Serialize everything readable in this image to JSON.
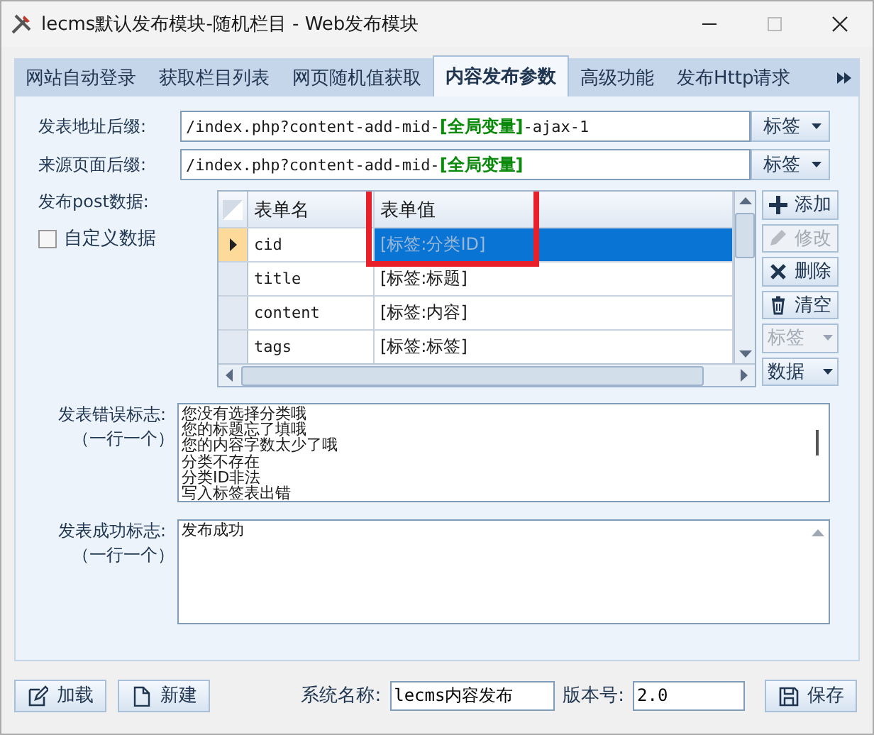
{
  "window": {
    "title": "lecms默认发布模块-随机栏目 - Web发布模块"
  },
  "tabs": [
    {
      "label": "网站自动登录",
      "selected": false
    },
    {
      "label": "获取栏目列表",
      "selected": false
    },
    {
      "label": "网页随机值获取",
      "selected": false
    },
    {
      "label": "内容发布参数",
      "selected": true
    },
    {
      "label": "高级功能",
      "selected": false
    },
    {
      "label": "发布Http请求",
      "selected": false
    }
  ],
  "fields": [
    {
      "label": "发表地址后缀:",
      "value": "/index.php?content-add-mid-**[全局变量]**-ajax-1",
      "button": "标签"
    },
    {
      "label": "来源页面后缀:",
      "value": "/index.php?content-add-mid-**[全局变量]**",
      "button": "标签"
    }
  ],
  "post_data": {
    "label": "发布post数据:",
    "custom": {
      "label": "自定义数据",
      "checked": false
    },
    "table": {
      "columns": [
        {
          "label": "表单名",
          "highlighted": false
        },
        {
          "label": "表单值",
          "highlighted": true
        }
      ],
      "rows": [
        {
          "name": "cid",
          "value": "[标签:分类ID]",
          "selected": true
        },
        {
          "name": "title",
          "value": "[标签:标题]",
          "selected": false
        },
        {
          "name": "content",
          "value": "[标签:内容]",
          "selected": false
        },
        {
          "name": "tags",
          "value": "[标签:标签]",
          "selected": false
        }
      ]
    },
    "buttons": [
      {
        "label": "添加",
        "kind": "plus",
        "disabled": false
      },
      {
        "label": "修改",
        "kind": "pencil",
        "disabled": true
      },
      {
        "label": "删除",
        "kind": "cross",
        "disabled": false
      },
      {
        "label": "清空",
        "kind": "trash",
        "disabled": false
      },
      {
        "label": "标签",
        "kind": "dropdown",
        "disabled": true
      },
      {
        "label": "数据",
        "kind": "dropdown",
        "disabled": false
      }
    ]
  },
  "error_marks": {
    "label": "发表错误标志:",
    "hint": "（一行一个）",
    "lines": [
      "您没有选择分类哦",
      "您的标题忘了填哦",
      "您的内容字数太少了哦",
      "分类不存在",
      "分类ID非法",
      "写入标签表出错"
    ]
  },
  "success_marks": {
    "label": "发表成功标志:",
    "hint": "（一行一个）",
    "lines": [
      "发布成功"
    ]
  },
  "footer": {
    "buttons": [
      {
        "label": "加载",
        "kind": "edit"
      },
      {
        "label": "新建",
        "kind": "file"
      }
    ],
    "system_name": {
      "label": "系统名称:",
      "value": "lecms内容发布"
    },
    "version": {
      "label": "版本号:",
      "value": "2.0"
    },
    "save": {
      "label": "保存",
      "kind": "disk"
    }
  }
}
